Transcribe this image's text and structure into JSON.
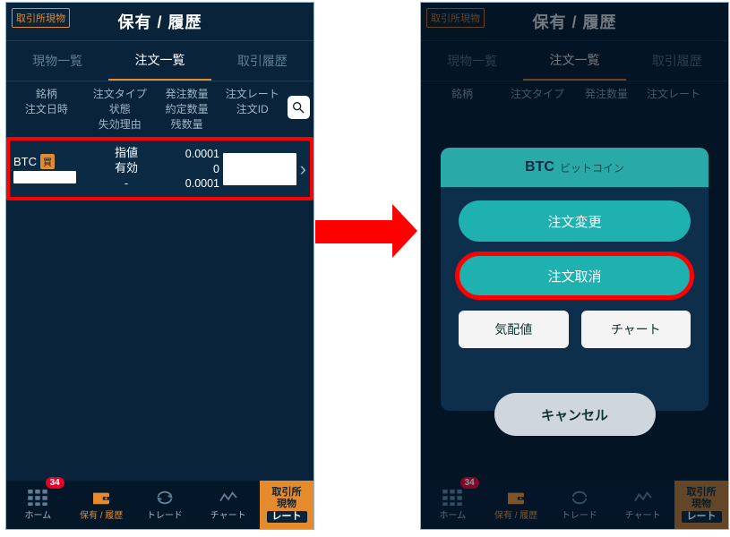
{
  "common": {
    "pill": "取引所現物",
    "title": "保有 / 履歴",
    "tabs": {
      "spot": "現物一覧",
      "orders": "注文一覧",
      "history": "取引履歴"
    },
    "thead": {
      "c1a": "銘柄",
      "c1b": "注文日時",
      "c2a": "注文タイプ",
      "c2b": "状態",
      "c2c": "失効理由",
      "c3a": "発注数量",
      "c3b": "約定数量",
      "c3c": "残数量",
      "c4a": "注文レート",
      "c4b": "注文ID"
    },
    "row": {
      "symbol": "BTC",
      "side": "買",
      "type": "指値",
      "state": "有効",
      "reason": "-",
      "qty_order": "0.0001",
      "qty_exec": "0",
      "qty_remain": "0.0001"
    },
    "nav": {
      "home": "ホーム",
      "hold": "保有 / 履歴",
      "trade": "トレード",
      "chart": "チャート",
      "rate1": "取引所",
      "rate2": "現物",
      "rate3": "レート",
      "badge": "34"
    }
  },
  "sheet": {
    "symbol": "BTC",
    "symbol_jp": "ビットコイン",
    "change": "注文変更",
    "cancelorder": "注文取消",
    "quote": "気配値",
    "chart": "チャート",
    "close": "キャンセル"
  }
}
